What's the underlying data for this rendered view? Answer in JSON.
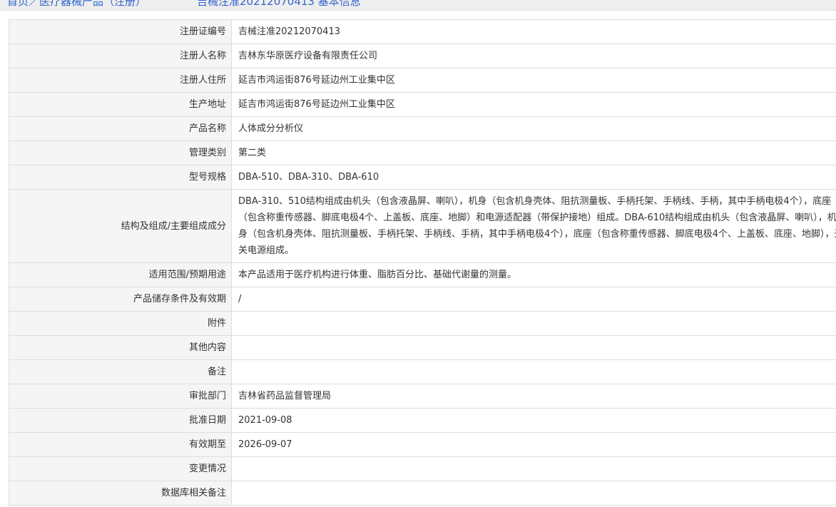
{
  "breadcrumb": {
    "left": "首页／医疗器械产品（注册）",
    "right": "吉械注准20212070413 基本信息"
  },
  "rows": [
    {
      "label": "注册证编号",
      "value": "吉械注准20212070413"
    },
    {
      "label": "注册人名称",
      "value": "吉林东华原医疗设备有限责任公司"
    },
    {
      "label": "注册人住所",
      "value": "延吉市鸿运街876号延边州工业集中区"
    },
    {
      "label": "生产地址",
      "value": "延吉市鸿运街876号延边州工业集中区"
    },
    {
      "label": "产品名称",
      "value": "人体成分分析仪"
    },
    {
      "label": "管理类别",
      "value": "第二类"
    },
    {
      "label": "型号规格",
      "value": "DBA-510、DBA-310、DBA-610"
    },
    {
      "label": "结构及组成/主要组成成分",
      "value": "DBA-310、510结构组成由机头（包含液晶屏、喇叭），机身（包含机身壳体、阻抗测量板、手柄托架、手柄线、手柄，其中手柄电极4个），底座（包含称重传感器、脚底电极4个、上盖板、底座、地脚）和电源适配器（带保护接地）组成。DBA-610结构组成由机头（包含液晶屏、喇叭），机身（包含机身壳体、阻抗测量板、手柄托架、手柄线、手柄，其中手柄电极4个），底座（包含称重传感器、脚底电极4个、上盖板、底座、地脚），开关电源组成。"
    },
    {
      "label": "适用范围/预期用途",
      "value": "本产品适用于医疗机构进行体重、脂肪百分比、基础代谢量的测量。"
    },
    {
      "label": "产品储存条件及有效期",
      "value": "/"
    },
    {
      "label": "附件",
      "value": ""
    },
    {
      "label": "其他内容",
      "value": ""
    },
    {
      "label": "备注",
      "value": ""
    },
    {
      "label": "审批部门",
      "value": "吉林省药品监督管理局"
    },
    {
      "label": "批准日期",
      "value": "2021-09-08"
    },
    {
      "label": "有效期至",
      "value": "2026-09-07"
    },
    {
      "label": "变更情况",
      "value": ""
    },
    {
      "label": "数据库相关备注",
      "value": ""
    }
  ]
}
